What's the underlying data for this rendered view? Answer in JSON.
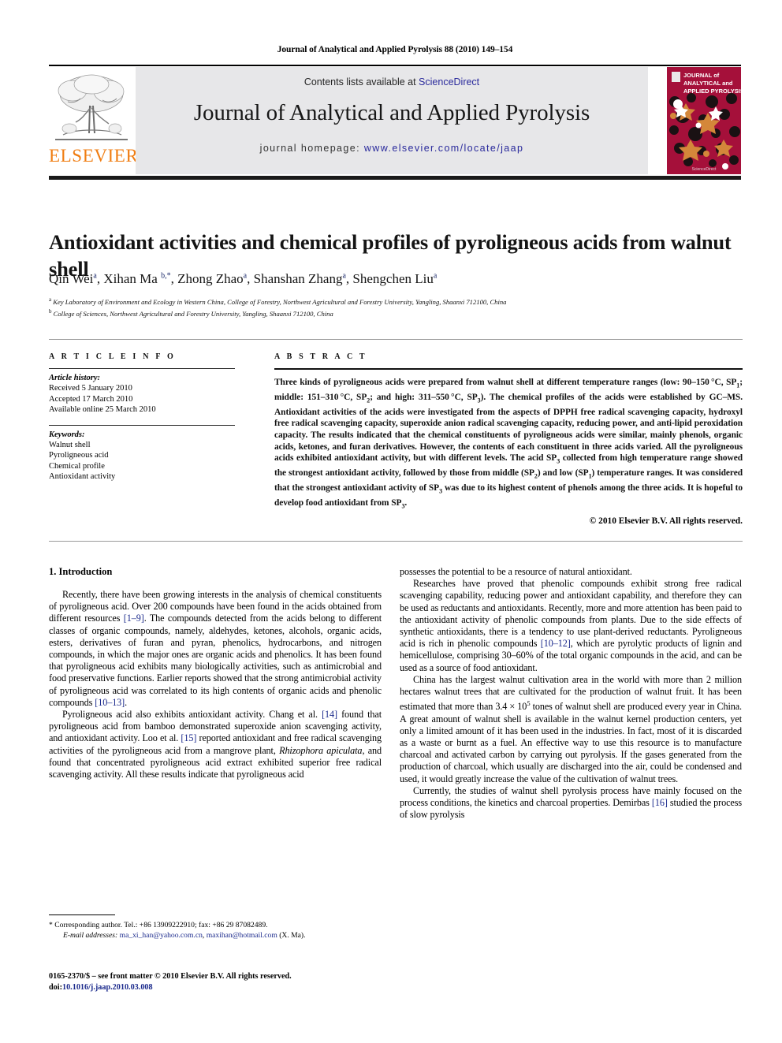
{
  "running_head": "Journal of Analytical and Applied Pyrolysis 88 (2010) 149–154",
  "masthead": {
    "contents_prefix": "Contents lists available at ",
    "sciencedirect": "ScienceDirect",
    "journal_title": "Journal of Analytical and Applied Pyrolysis",
    "homepage_prefix": "journal homepage: ",
    "homepage_url": "www.elsevier.com/locate/jaap",
    "publisher": "ELSEVIER",
    "cover_title_line1": "JOURNAL of",
    "cover_title_line2": "ANALYTICAL and",
    "cover_title_line3": "APPLIED PYROLYSIS",
    "cover_footer": "ScienceDirect",
    "accent_orange": "#f07d12",
    "cover_red": "#a5103a",
    "link_blue": "#2a2a9c",
    "band_gray": "#e7e7e9"
  },
  "article": {
    "title": "Antioxidant activities and chemical profiles of pyroligneous acids from walnut shell",
    "authors_html": "Qin Wei<sup>a</sup>, Xihan Ma <sup>b,<span class=\"star\">*</span></sup>, Zhong Zhao<sup>a</sup>, Shanshan Zhang<sup>a</sup>, Shengchen Liu<sup>a</sup>",
    "affiliation_a": "Key Laboratory of Environment and Ecology in Western China, College of Forestry, Northwest Agricultural and Forestry University, Yangling, Shaanxi 712100, China",
    "affiliation_b": "College of Sciences, Northwest Agricultural and Forestry University, Yangling, Shaanxi 712100, China"
  },
  "article_info": {
    "heading": "A R T I C L E  I N F O",
    "history_label": "Article history:",
    "history": [
      "Received 5 January 2010",
      "Accepted 17 March 2010",
      "Available online 25 March 2010"
    ],
    "keywords_label": "Keywords:",
    "keywords": [
      "Walnut shell",
      "Pyroligneous acid",
      "Chemical profile",
      "Antioxidant activity"
    ]
  },
  "abstract": {
    "heading": "A B S T R A C T",
    "body_html": "Three kinds of pyroligneous acids were prepared from walnut shell at different temperature ranges (low: 90–150&#8201;°C, SP<sub>1</sub>; middle: 151–310&#8201;°C, SP<sub>2</sub>; and high: 311–550&#8201;°C, SP<sub>3</sub>). The chemical profiles of the acids were established by GC–MS. Antioxidant activities of the acids were investigated from the aspects of DPPH free radical scavenging capacity, hydroxyl free radical scavenging capacity, superoxide anion radical scavenging capacity, reducing power, and anti-lipid peroxidation capacity. The results indicated that the chemical constituents of pyroligneous acids were similar, mainly phenols, organic acids, ketones, and furan derivatives. However, the contents of each constituent in three acids varied. All the pyroligneous acids exhibited antioxidant activity, but with different levels. The acid SP<sub>3</sub> collected from high temperature range showed the strongest antioxidant activity, followed by those from middle (SP<sub>2</sub>) and low (SP<sub>1</sub>) temperature ranges. It was considered that the strongest antioxidant activity of SP<sub>3</sub> was due to its highest content of phenols among the three acids. It is hopeful to develop food antioxidant from SP<sub>3</sub>.",
    "copyright": "© 2010 Elsevier B.V. All rights reserved."
  },
  "body": {
    "section_heading": "1. Introduction",
    "left_paragraphs_html": [
      "Recently, there have been growing interests in the analysis of chemical constituents of pyroligneous acid. Over 200 compounds have been found in the acids obtained from different resources <span class=\"ref\">[1–9]</span>. The compounds detected from the acids belong to different classes of organic compounds, namely, aldehydes, ketones, alcohols, organic acids, esters, derivatives of furan and pyran, phenolics, hydrocarbons, and nitrogen compounds, in which the major ones are organic acids and phenolics. It has been found that pyroligneous acid exhibits many biologically activities, such as antimicrobial and food preservative functions. Earlier reports showed that the strong antimicrobial activity of pyroligneous acid was correlated to its high contents of organic acids and phenolic compounds <span class=\"ref\">[10–13]</span>.",
      "Pyroligneous acid also exhibits antioxidant activity. Chang et al. <span class=\"ref\">[14]</span> found that pyroligneous acid from bamboo demonstrated superoxide anion scavenging activity, and antioxidant activity. Loo et al. <span class=\"ref\">[15]</span> reported antioxidant and free radical scavenging activities of the pyroligneous acid from a mangrove plant, <span class=\"ital\">Rhizophora apiculata</span>, and found that concentrated pyroligneous acid extract exhibited superior free radical scavenging activity. All these results indicate that pyroligneous acid"
    ],
    "right_paragraphs_html": [
      "possesses the potential to be a resource of natural antioxidant.",
      "Researches have proved that phenolic compounds exhibit strong free radical scavenging capability, reducing power and antioxidant capability, and therefore they can be used as reductants and antioxidants. Recently, more and more attention has been paid to the antioxidant activity of phenolic compounds from plants. Due to the side effects of synthetic antioxidants, there is a tendency to use plant-derived reductants. Pyroligneous acid is rich in phenolic compounds <span class=\"ref\">[10–12]</span>, which are pyrolytic products of lignin and hemicellulose, comprising 30–60% of the total organic compounds in the acid, and can be used as a source of food antioxidant.",
      "China has the largest walnut cultivation area in the world with more than 2 million hectares walnut trees that are cultivated for the production of walnut fruit. It has been estimated that more than 3.4 × 10<sup>5</sup> tones of walnut shell are produced every year in China. A great amount of walnut shell is available in the walnut kernel production centers, yet only a limited amount of it has been used in the industries. In fact, most of it is discarded as a waste or burnt as a fuel. An effective way to use this resource is to manufacture charcoal and activated carbon by carrying out pyrolysis. If the gases generated from the production of charcoal, which usually are discharged into the air, could be condensed and used, it would greatly increase the value of the cultivation of walnut trees.",
      "Currently, the studies of walnut shell pyrolysis process have mainly focused on the process conditions, the kinetics and charcoal properties. Demirbas <span class=\"ref\">[16]</span> studied the process of slow pyrolysis"
    ]
  },
  "footnote": {
    "line1_html": "* Corresponding author. Tel.: +86 13909222910; fax: +86 29 87082489.",
    "line2_html": "<span class=\"fn-ital\">E-mail addresses:</span> <span class=\"email\">ma_xi_han@yahoo.com.cn</span>, <span class=\"email\">maxihan@hotmail.com</span> (X. Ma)."
  },
  "bottom_matter": {
    "line1": "0165-2370/$ – see front matter © 2010 Elsevier B.V. All rights reserved.",
    "doi_prefix": "doi:",
    "doi": "10.1016/j.jaap.2010.03.008"
  }
}
